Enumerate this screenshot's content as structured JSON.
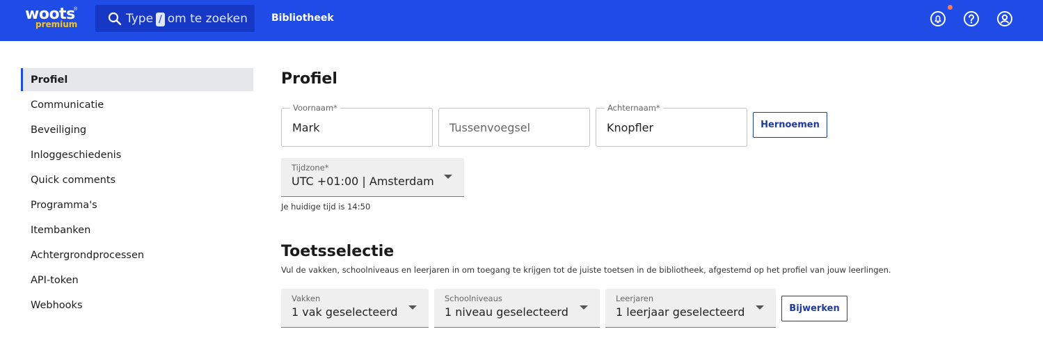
{
  "header": {
    "logo_text": "woots",
    "logo_tm": "®",
    "logo_sub": "premium",
    "search_prefix": "Type",
    "search_key": "/",
    "search_suffix": "om te zoeken",
    "nav_library": "Bibliotheek",
    "icons": [
      "bell-icon",
      "help-icon",
      "account-icon"
    ],
    "notification_dot_color": "#ff7a59",
    "brand_color": "#1f4be6"
  },
  "sidebar": {
    "items": [
      {
        "label": "Profiel",
        "active": true
      },
      {
        "label": "Communicatie"
      },
      {
        "label": "Beveiliging"
      },
      {
        "label": "Inloggeschiedenis"
      },
      {
        "label": "Quick comments"
      },
      {
        "label": "Programma's"
      },
      {
        "label": "Itembanken"
      },
      {
        "label": "Achtergrondprocessen"
      },
      {
        "label": "API-token"
      },
      {
        "label": "Webhooks"
      }
    ]
  },
  "profile": {
    "title": "Profiel",
    "first_name_label": "Voornaam*",
    "first_name_value": "Mark",
    "infix_placeholder": "Tussenvoegsel",
    "last_name_label": "Achternaam*",
    "last_name_value": "Knopfler",
    "rename_button": "Hernoemen",
    "timezone_label": "Tijdzone*",
    "timezone_value": "UTC +01:00 | Amsterdam",
    "current_time_text": "Je huidige tijd is 14:50"
  },
  "test_selection": {
    "title": "Toetsselectie",
    "description": "Vul de vakken, schoolniveaus en leerjaren in om toegang te krijgen tot de juiste toetsen in de bibliotheek, afgestemd op het profiel van jouw leerlingen.",
    "subjects_label": "Vakken",
    "subjects_value": "1 vak geselecteerd",
    "levels_label": "Schoolniveaus",
    "levels_value": "1 niveau geselecteerd",
    "years_label": "Leerjaren",
    "years_value": "1 leerjaar geselecteerd",
    "update_button": "Bijwerken"
  }
}
